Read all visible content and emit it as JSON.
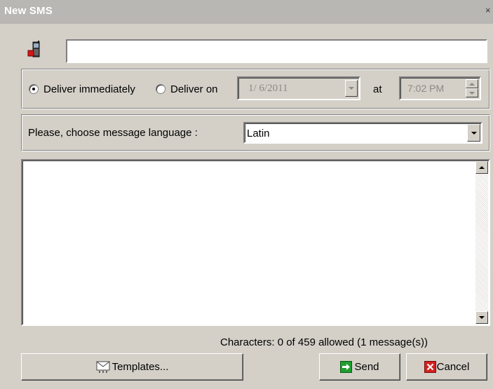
{
  "window": {
    "title": "New SMS",
    "close_glyph": "×"
  },
  "recipient": {
    "icon": "mobile-phone-icon",
    "value": ""
  },
  "delivery": {
    "immediately_label": "Deliver immediately",
    "on_label": "Deliver on",
    "selected": "immediately",
    "date_value": "1/ 6/2011",
    "at_label": "at",
    "time_value": "7:02 PM"
  },
  "language": {
    "label": "Please, choose message language :",
    "selected": "Latin"
  },
  "message": {
    "value": ""
  },
  "counter": {
    "text": "Characters: 0 of 459 allowed (1 message(s))"
  },
  "buttons": {
    "templates": "Templates...",
    "send": "Send",
    "cancel": "Cancel"
  },
  "colors": {
    "face": "#d4d0c8",
    "send_icon": "#1e9e2e",
    "cancel_icon": "#d42020"
  }
}
